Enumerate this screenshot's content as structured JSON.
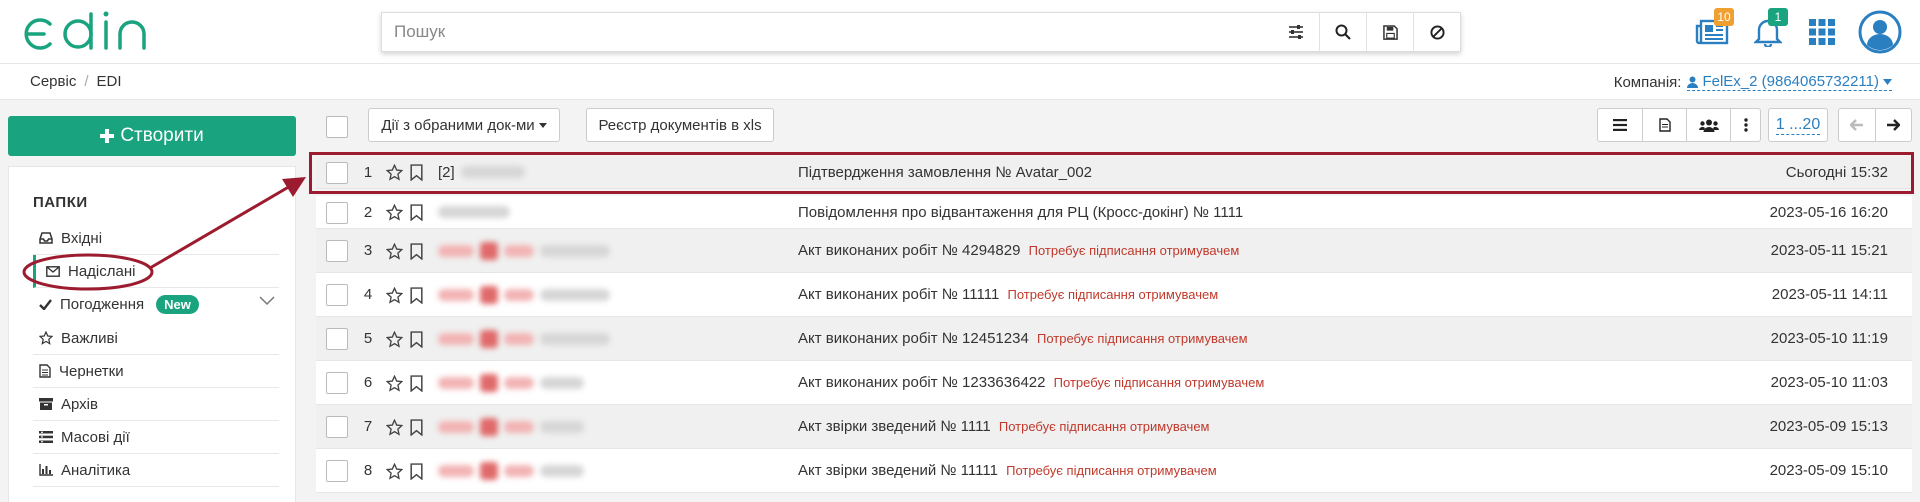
{
  "header": {
    "search_placeholder": "Пошук",
    "notifications": {
      "news_count": "10",
      "bell_count": "1"
    },
    "colors": {
      "brand": "#1aa37f",
      "news_badge": "#f0a030",
      "bell_badge": "#1aa37f",
      "icon_blue": "#2a7fc1"
    }
  },
  "breadcrumbs": {
    "items": [
      "Сервіс",
      "EDI"
    ],
    "separator": "/"
  },
  "company": {
    "label": "Компанія:",
    "value": "FelEx_2 (9864065732211)"
  },
  "sidebar": {
    "create_label": "Створити",
    "folders_title": "ПАПКИ",
    "items": [
      {
        "label": "Вхідні",
        "icon": "inbox-icon"
      },
      {
        "label": "Надіслані",
        "icon": "envelope-icon",
        "active": true
      },
      {
        "label": "Погодження",
        "icon": "check-icon",
        "badge": "New"
      },
      {
        "label": "Важливі",
        "icon": "star-icon"
      },
      {
        "label": "Чернетки",
        "icon": "file-icon"
      },
      {
        "label": "Архів",
        "icon": "archive-icon"
      },
      {
        "label": "Масові дії",
        "icon": "list-icon"
      },
      {
        "label": "Аналітика",
        "icon": "chart-icon"
      }
    ]
  },
  "toolbar": {
    "actions_label": "Дії з обраними док-ми",
    "registry_label": "Реєстр документів в xls",
    "pager": "1 ...20"
  },
  "documents": [
    {
      "num": "1",
      "sender_prefix": "[2]",
      "title": "Підтвердження замовлення № Avatar_002",
      "status": "",
      "date": "Сьогодні 15:32"
    },
    {
      "num": "2",
      "sender_prefix": "",
      "title": "Повідомлення про відвантаження для РЦ (Кросс-докінг) № 1111",
      "status": "",
      "date": "2023-05-16 16:20"
    },
    {
      "num": "3",
      "sender_prefix": "",
      "title": "Акт виконаних робіт № 4294829",
      "status": "Потребує підписання отримувачем",
      "date": "2023-05-11 15:21"
    },
    {
      "num": "4",
      "sender_prefix": "",
      "title": "Акт виконаних робіт № 11111",
      "status": "Потребує підписання отримувачем",
      "date": "2023-05-11 14:11"
    },
    {
      "num": "5",
      "sender_prefix": "",
      "title": "Акт виконаних робіт № 12451234",
      "status": "Потребує підписання отримувачем",
      "date": "2023-05-10 11:19"
    },
    {
      "num": "6",
      "sender_prefix": "",
      "title": "Акт виконаних робіт № 1233636422",
      "status": "Потребує підписання отримувачем",
      "date": "2023-05-10 11:03"
    },
    {
      "num": "7",
      "sender_prefix": "",
      "title": "Акт звірки зведений № 1111",
      "status": "Потребує підписання отримувачем",
      "date": "2023-05-09 15:13"
    },
    {
      "num": "8",
      "sender_prefix": "",
      "title": "Акт звірки зведений № 11111",
      "status": "Потребує підписання отримувачем",
      "date": "2023-05-09 15:10"
    }
  ],
  "annotation": {
    "color": "#9c1b2e"
  }
}
